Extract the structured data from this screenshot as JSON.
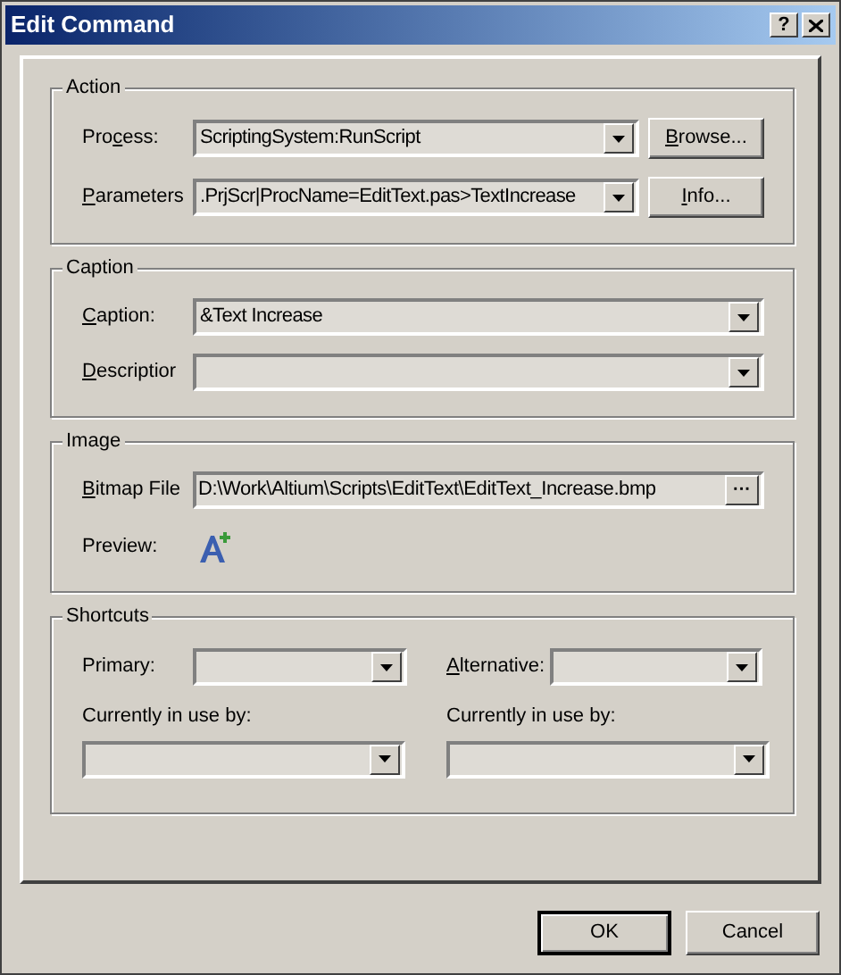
{
  "window": {
    "title": "Edit Command",
    "help": "?"
  },
  "groups": [
    {
      "kind": "fields",
      "title": "Action",
      "fields": [
        {
          "kind": "combo",
          "label": {
            "pre": "Pro",
            "key": "c",
            "post": "ess:"
          },
          "value": "ScriptingSystem:RunScript",
          "button": {
            "key": "B",
            "post": "rowse..."
          }
        },
        {
          "kind": "combo",
          "label": {
            "key": "P",
            "post": "arameters"
          },
          "value": ".PrjScr|ProcName=EditText.pas>TextIncrease",
          "button": {
            "key": "I",
            "post": "nfo..."
          }
        }
      ]
    },
    {
      "kind": "fields",
      "title": "Caption",
      "fields": [
        {
          "kind": "combo",
          "label": {
            "key": "C",
            "post": "aption:"
          },
          "value": "&Text Increase"
        },
        {
          "kind": "combo",
          "label": {
            "key": "D",
            "post": "escriptior"
          }
        }
      ]
    },
    {
      "kind": "fields",
      "title": "Image",
      "fields": [
        {
          "kind": "file",
          "label": {
            "key": "B",
            "post": "itmap File"
          },
          "value": "D:\\Work\\Altium\\Scripts\\EditText\\EditText_Increase.bmp",
          "button_label": "···"
        },
        {
          "kind": "preview",
          "label": {
            "pre": "Preview:"
          }
        }
      ]
    },
    {
      "kind": "shortcuts",
      "title": "Shortcuts",
      "columns": [
        {
          "label": {
            "pre": "Primary:"
          },
          "in_use_label": "Currently in use by:"
        },
        {
          "label": {
            "key": "A",
            "post": "lternative:"
          },
          "in_use_label": "Currently in use by:"
        }
      ]
    }
  ],
  "buttons": [
    {
      "label": "OK",
      "default": true
    },
    {
      "label": "Cancel",
      "default": false
    }
  ]
}
